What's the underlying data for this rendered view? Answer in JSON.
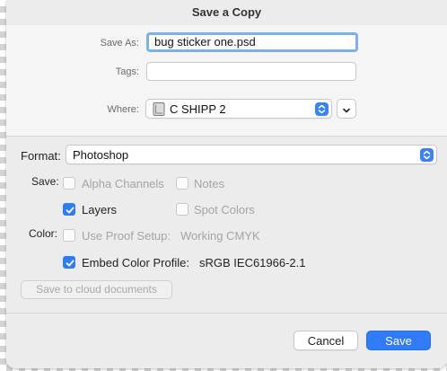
{
  "dialog": {
    "title": "Save a Copy",
    "save_as_label": "Save As:",
    "save_as_value": "bug sticker one.psd",
    "tags_label": "Tags:",
    "tags_value": "",
    "where_label": "Where:",
    "where_value": "C SHIPP 2",
    "format_label": "Format:",
    "format_value": "Photoshop",
    "save_label": "Save:",
    "color_label": "Color:"
  },
  "options": {
    "alpha_channels": {
      "label": "Alpha Channels",
      "checked": false,
      "enabled": false
    },
    "notes": {
      "label": "Notes",
      "checked": false,
      "enabled": false
    },
    "layers": {
      "label": "Layers",
      "checked": true,
      "enabled": true
    },
    "spot_colors": {
      "label": "Spot Colors",
      "checked": false,
      "enabled": false
    },
    "use_proof_setup": {
      "label": "Use Proof Setup:",
      "value": "Working CMYK",
      "checked": false,
      "enabled": false
    },
    "embed_color_profile": {
      "label": "Embed Color Profile:",
      "value": "sRGB IEC61966-2.1",
      "checked": true,
      "enabled": true
    }
  },
  "buttons": {
    "cloud": "Save to cloud documents",
    "cancel": "Cancel",
    "save": "Save"
  },
  "colors": {
    "accent": "#2f7cf6",
    "focus_ring": "#7eb0ee"
  },
  "icons": {
    "drive": "hard-drive-icon",
    "popup": "up-down-chevron-icon",
    "expand": "chevron-down-icon"
  }
}
